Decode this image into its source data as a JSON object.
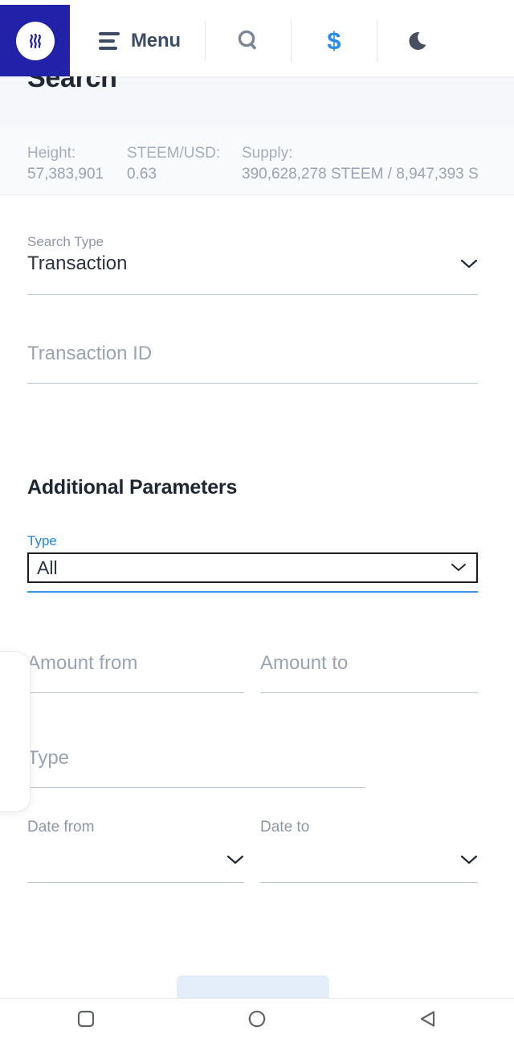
{
  "header": {
    "logo_icon": "steem-logo-icon",
    "menu_label": "Menu",
    "search_icon": "search-icon",
    "currency_icon": "dollar-icon",
    "theme_icon": "moon-icon",
    "brand_color": "#2222a8",
    "accent_color": "#2b8aef"
  },
  "page": {
    "title": "Search"
  },
  "stats": [
    {
      "key": "Height:",
      "value": "57,383,901"
    },
    {
      "key": "STEEM/USD:",
      "value": "0.63"
    },
    {
      "key": "Supply:",
      "value": "390,628,278 STEEM / 8,947,393 S"
    }
  ],
  "form": {
    "search_type": {
      "label": "Search Type",
      "value": "Transaction",
      "chevron_icon": "chevron-down-icon"
    },
    "transaction_id": {
      "placeholder": "Transaction ID",
      "value": ""
    },
    "section_title": "Additional Parameters",
    "type_select": {
      "label": "Type",
      "value": "All",
      "chevron_icon": "chevron-down-icon",
      "focus_color": "#1e88e5",
      "underline_color": "#3b97e8"
    },
    "amount_from": {
      "placeholder": "Amount from",
      "value": ""
    },
    "amount_to": {
      "placeholder": "Amount to",
      "value": ""
    },
    "type_text": {
      "placeholder": "Type",
      "value": ""
    },
    "date_from": {
      "label": "Date from",
      "value": "",
      "chevron_icon": "chevron-down-icon"
    },
    "date_to": {
      "label": "Date to",
      "value": "",
      "chevron_icon": "chevron-down-icon"
    },
    "submit": {
      "label": "",
      "color": "#e3eefa"
    }
  },
  "navbar": {
    "recents_icon": "square-icon",
    "home_icon": "circle-icon",
    "back_icon": "triangle-left-icon"
  }
}
